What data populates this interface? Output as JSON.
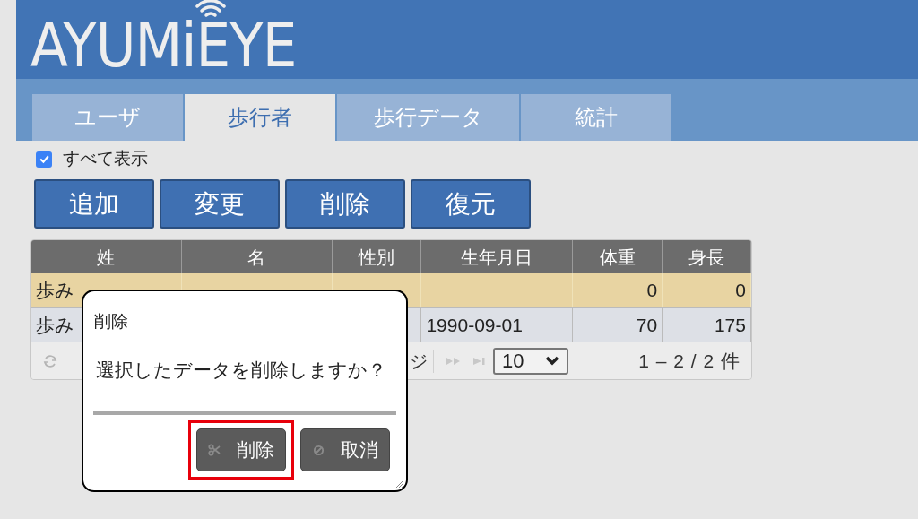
{
  "logo": "AYUMiEYE",
  "tabs": [
    {
      "label": "ユーザ",
      "selected": false
    },
    {
      "label": "歩行者",
      "selected": true
    },
    {
      "label": "歩行データ",
      "selected": false
    },
    {
      "label": "統計",
      "selected": false
    }
  ],
  "show_all": {
    "label": "すべて表示",
    "checked": true
  },
  "toolbar": [
    "追加",
    "変更",
    "削除",
    "復元"
  ],
  "table": {
    "columns": [
      "姓",
      "名",
      "性別",
      "生年月日",
      "体重",
      "身長"
    ],
    "rows": [
      {
        "selected": true,
        "cells": [
          "歩み",
          "",
          "",
          "",
          "0",
          "0"
        ]
      },
      {
        "selected": false,
        "cells": [
          "歩み",
          "",
          "",
          "1990-09-01",
          "70",
          "175"
        ]
      }
    ]
  },
  "pager": {
    "page_label": "ジ",
    "page_size": "10",
    "summary": "1 – 2 / 2 件"
  },
  "dialog": {
    "title": "削除",
    "message": "選択したデータを削除しますか？",
    "buttons": [
      {
        "label": "削除",
        "kind": "delete",
        "highlighted": true
      },
      {
        "label": "取消",
        "kind": "cancel",
        "highlighted": false
      }
    ]
  }
}
